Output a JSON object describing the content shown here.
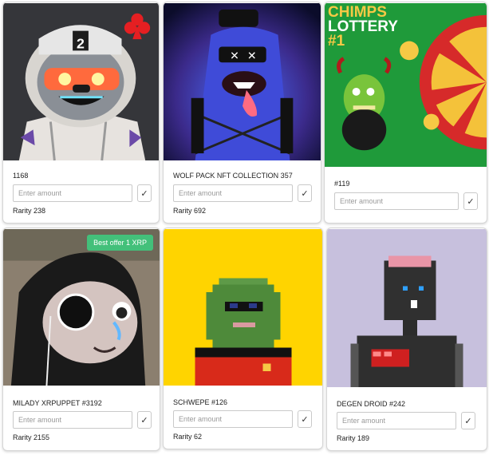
{
  "cards": [
    {
      "title": "1168",
      "placeholder": "Enter amount",
      "confirm": "✓",
      "rarity": "Rarity 238"
    },
    {
      "title": "WOLF PACK NFT COLLECTION 357",
      "placeholder": "Enter amount",
      "confirm": "✓",
      "rarity": "Rarity 692"
    },
    {
      "title": "#119",
      "placeholder": "Enter amount",
      "confirm": "✓",
      "rarity": "",
      "image_text": {
        "line1": "CHIMPS",
        "line2": "LOTTERY",
        "line3": "#1"
      }
    },
    {
      "title": "MILADY XRPUPPET #3192",
      "placeholder": "Enter amount",
      "confirm": "✓",
      "rarity": "Rarity 2155",
      "badge": "Best offer 1 XRP"
    },
    {
      "title": "SCHWEPE #126",
      "placeholder": "Enter amount",
      "confirm": "✓",
      "rarity": "Rarity 62"
    },
    {
      "title": "DEGEN DROID #242",
      "placeholder": "Enter amount",
      "confirm": "✓",
      "rarity": "Rarity 189"
    }
  ],
  "colors": {
    "badge": "#43c07a",
    "card_border": "#d6d6d6",
    "chimps_bg": "#1f9a3a",
    "schwepe_bg": "#ffd400",
    "droid_bg": "#c7c0dd"
  },
  "icons": [
    "club-suit-icon",
    "check-icon"
  ]
}
